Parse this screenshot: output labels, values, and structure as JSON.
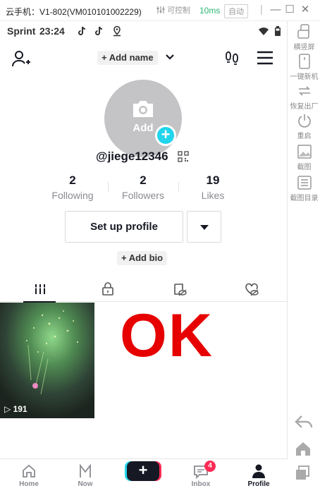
{
  "emulator": {
    "title": "云手机：V1-802(VM010101002229)",
    "controls_label": "可控制",
    "latency": "10ms",
    "auto_label": "自动",
    "side_tools": [
      {
        "label": "横竖屏",
        "icon": "rotate-screen-icon"
      },
      {
        "label": "一键新机",
        "icon": "new-device-icon"
      },
      {
        "label": "恢复出厂",
        "icon": "factory-reset-icon"
      },
      {
        "label": "重启",
        "icon": "power-icon"
      },
      {
        "label": "截图",
        "icon": "screenshot-icon"
      },
      {
        "label": "截图目录",
        "icon": "screenshot-folder-icon"
      }
    ]
  },
  "statusbar": {
    "carrier": "Sprint",
    "time": "23:24"
  },
  "profile": {
    "add_name": "+ Add name",
    "avatar_add": "Add",
    "username": "@jiege12346",
    "stats": [
      {
        "value": "2",
        "label": "Following"
      },
      {
        "value": "2",
        "label": "Followers"
      },
      {
        "value": "19",
        "label": "Likes"
      }
    ],
    "setup_button": "Set up profile",
    "add_bio": "+ Add bio"
  },
  "tabs": [
    "videos-tab",
    "private-tab",
    "tagged-tab",
    "liked-tab"
  ],
  "videos": [
    {
      "views": "191"
    }
  ],
  "overlay_text": "OK",
  "bottom_nav": [
    {
      "label": "Home",
      "icon": "home-icon"
    },
    {
      "label": "Now",
      "icon": "now-icon"
    },
    {
      "label": "",
      "icon": "create-icon"
    },
    {
      "label": "Inbox",
      "icon": "inbox-icon",
      "badge": "4"
    },
    {
      "label": "Profile",
      "icon": "profile-icon"
    }
  ],
  "colors": {
    "accent_cyan": "#20d5ec",
    "accent_red": "#fe2c55",
    "ok_red": "#e60000"
  }
}
